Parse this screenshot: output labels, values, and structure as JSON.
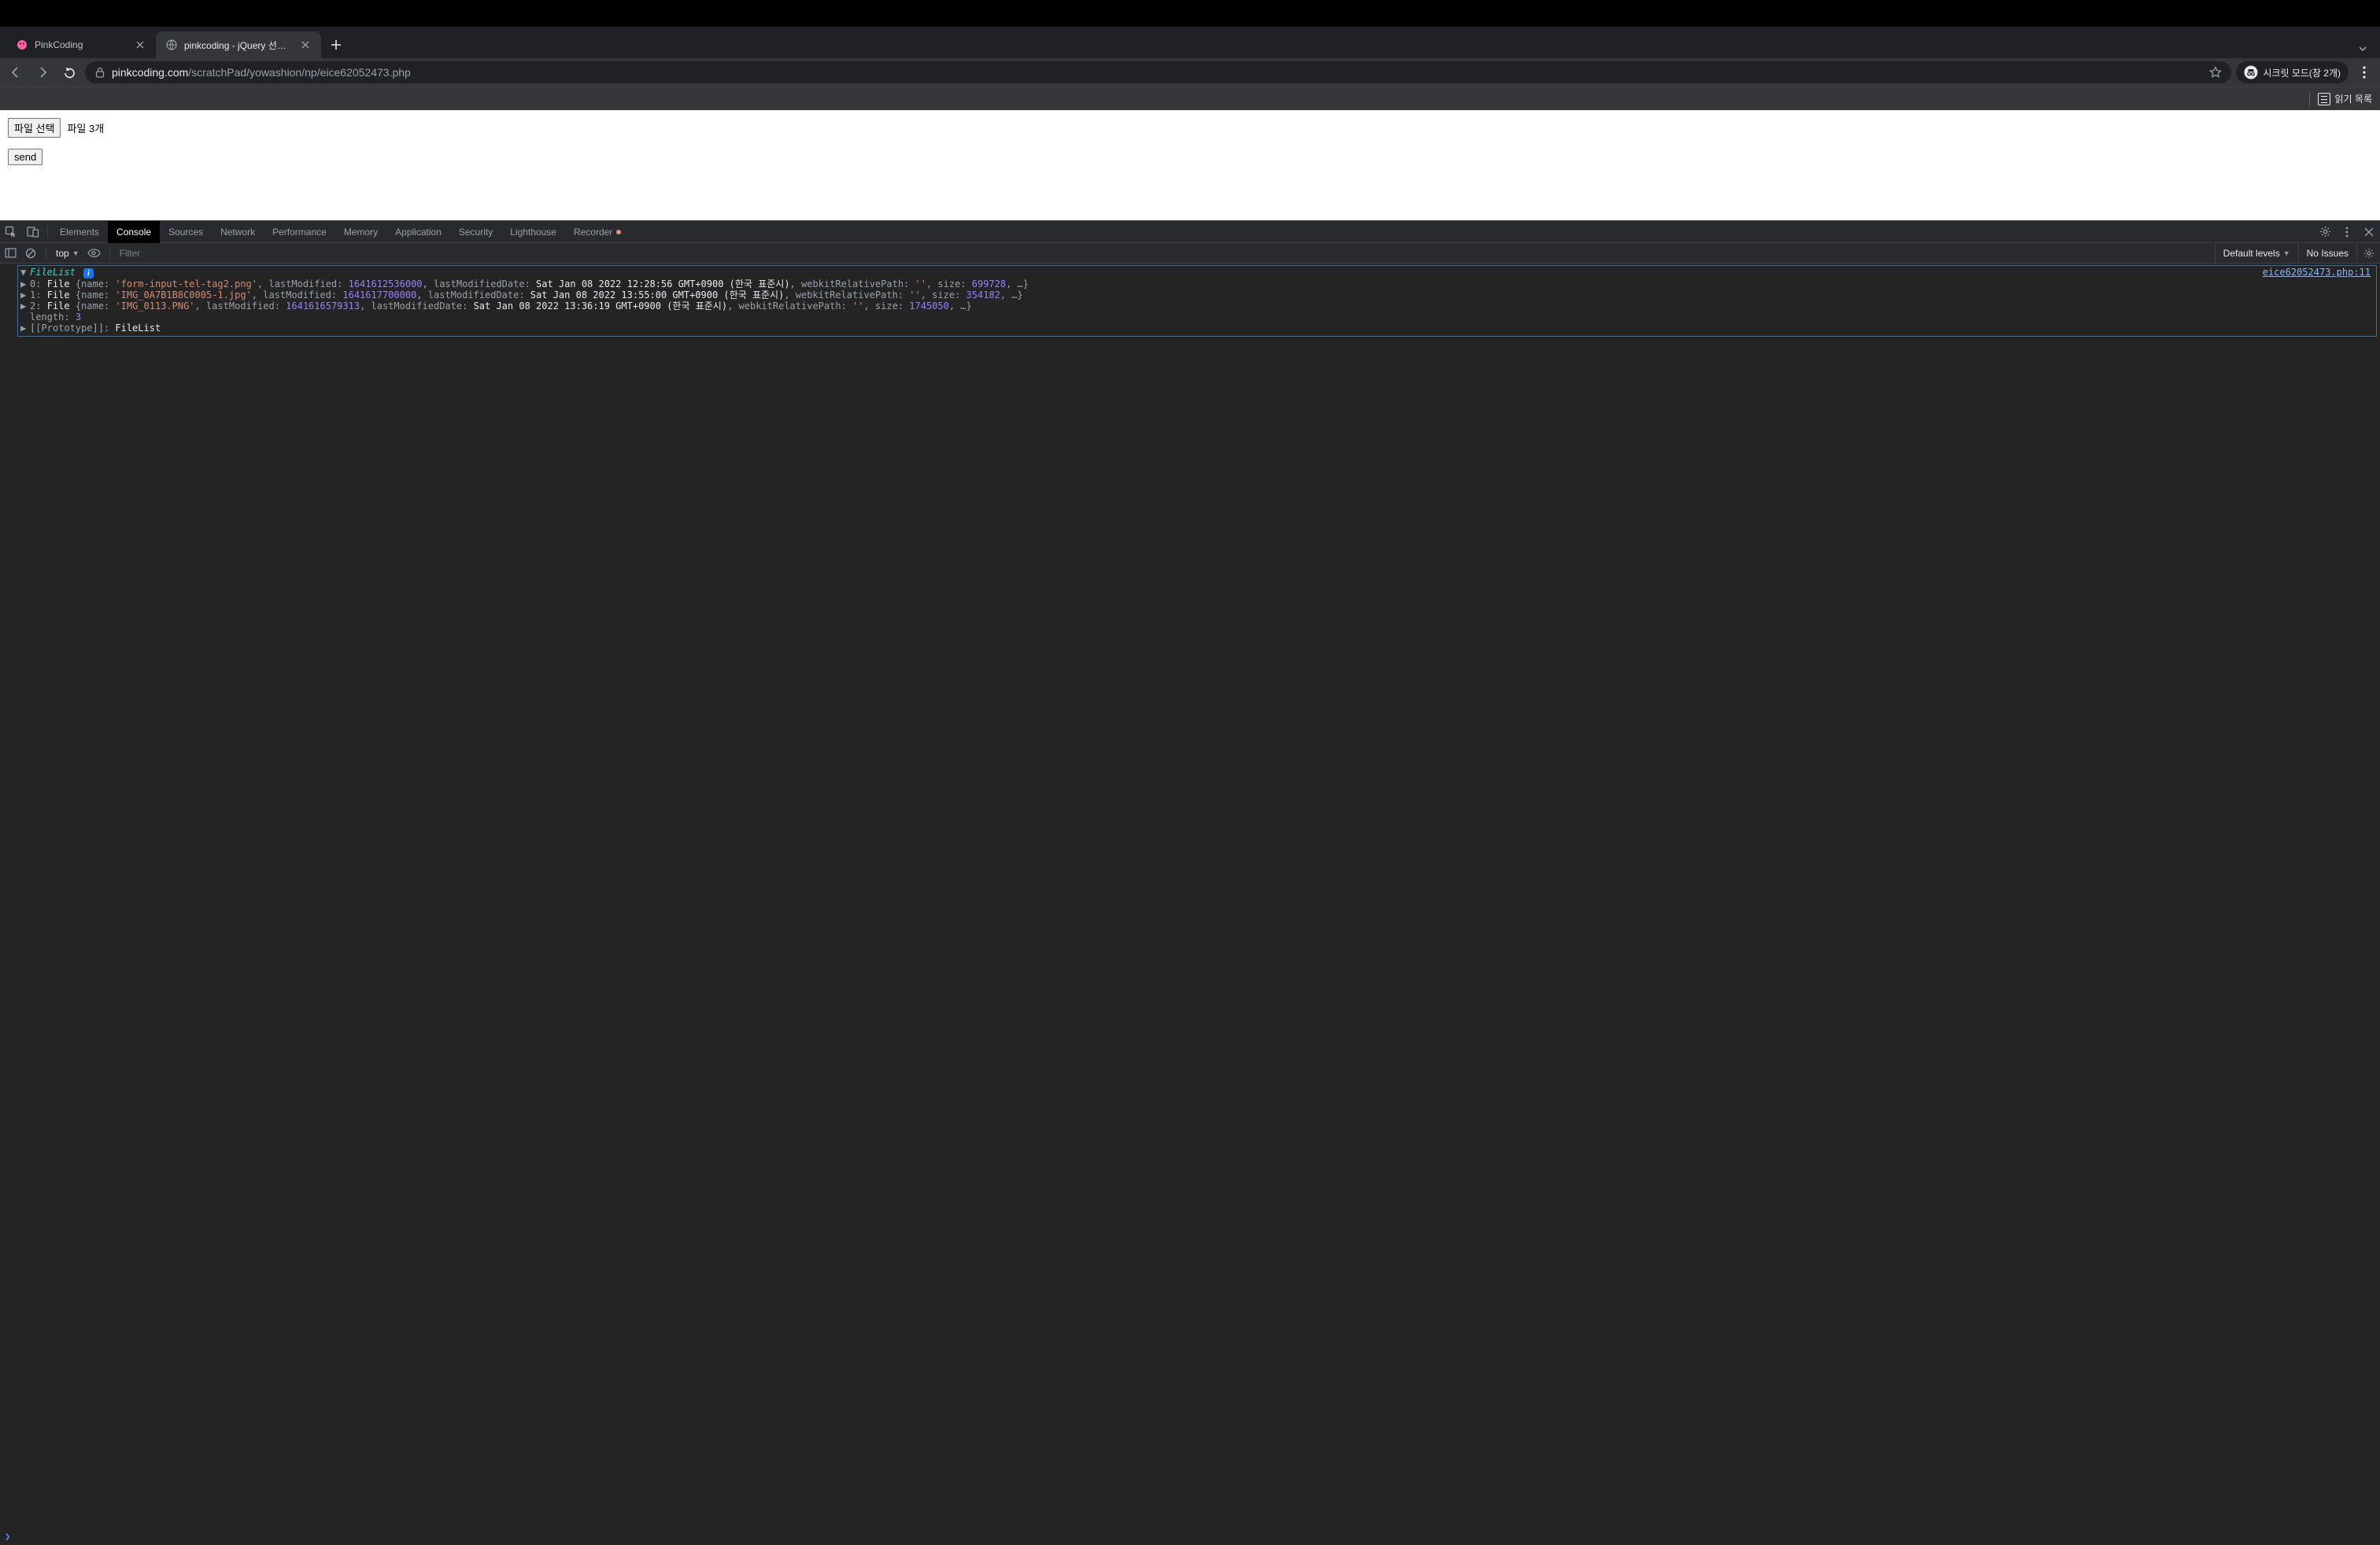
{
  "tabs": [
    {
      "title": "PinkCoding",
      "active": false,
      "favicon": "pink"
    },
    {
      "title": "pinkcoding - jQuery 선택한 파일",
      "active": true,
      "favicon": "globe"
    }
  ],
  "addr": {
    "host": "pinkcoding.com",
    "path": "/scratchPad/yowashion/np/eice62052473.php"
  },
  "incognito_label": "시크릿 모드(창 2개)",
  "bookbar_item": "읽기 목록",
  "page": {
    "file_button": "파일 선택",
    "file_status": "파일 3개",
    "send_button": "send"
  },
  "devtools": {
    "tabs": [
      "Elements",
      "Console",
      "Sources",
      "Network",
      "Performance",
      "Memory",
      "Application",
      "Security",
      "Lighthouse",
      "Recorder"
    ],
    "active_tab": "Console",
    "context": "top",
    "filter_placeholder": "Filter",
    "levels_label": "Default levels",
    "issues_label": "No Issues",
    "source_link": "eice62052473.php:11",
    "object_header": "FileList",
    "files": [
      {
        "idx": 0,
        "name": "form-input-tel-tag2.png",
        "lastModified": 1641612536000,
        "lastModifiedDate": "Sat Jan 08 2022 12:28:56 GMT+0900 (한국 표준시)",
        "webkitRelativePath": "",
        "size": 699728
      },
      {
        "idx": 1,
        "name": "IMG_0A7B1B8C0005-1.jpg",
        "lastModified": 1641617700000,
        "lastModifiedDate": "Sat Jan 08 2022 13:55:00 GMT+0900 (한국 표준시)",
        "webkitRelativePath": "",
        "size": 354182
      },
      {
        "idx": 2,
        "name": "IMG_0113.PNG",
        "lastModified": 1641616579313,
        "lastModifiedDate": "Sat Jan 08 2022 13:36:19 GMT+0900 (한국 표준시)",
        "webkitRelativePath": "",
        "size": 1745050
      }
    ],
    "length_label": "length",
    "length_value": 3,
    "proto_label": "[[Prototype]]",
    "proto_value": "FileList"
  }
}
